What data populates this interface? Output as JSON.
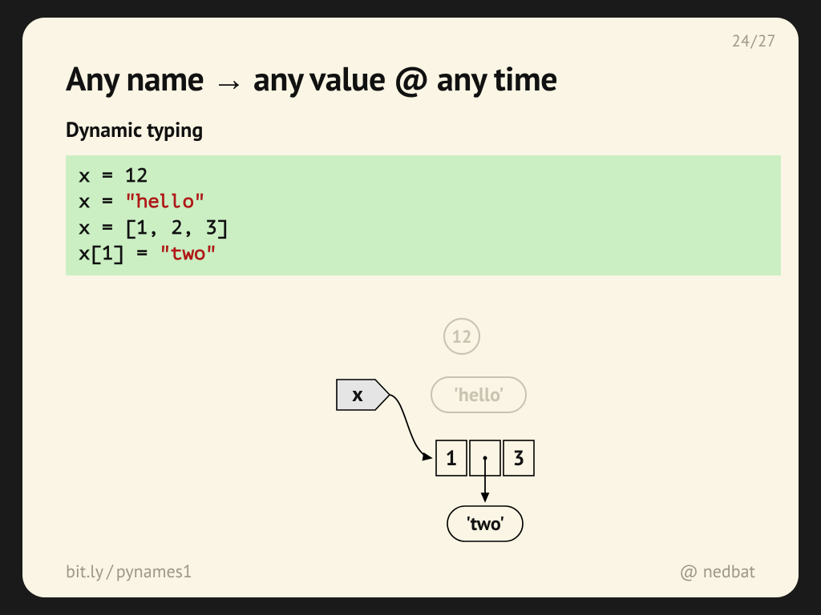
{
  "page": {
    "current": "24",
    "total": "27"
  },
  "title": "Any name → any value @ any time",
  "subtitle": "Dynamic typing",
  "code": {
    "l1a": "x = ",
    "l1b": "12",
    "l2a": "x = ",
    "l2b": "\"hello\"",
    "l3a": "x = [",
    "l3b": "1",
    "l3c": ", ",
    "l3d": "2",
    "l3e": ", ",
    "l3f": "3",
    "l3g": "]",
    "l4a": "x[",
    "l4b": "1",
    "l4c": "] = ",
    "l4d": "\"two\""
  },
  "diagram": {
    "name": "x",
    "ghost_int": "12",
    "ghost_str": "'hello'",
    "cell_left": "1",
    "cell_right": "3",
    "ref_value": "'two'"
  },
  "footer": {
    "link_host": "bit.ly",
    "link_path": "pynames1",
    "handle_prefix": "@",
    "handle": "nedbat"
  }
}
